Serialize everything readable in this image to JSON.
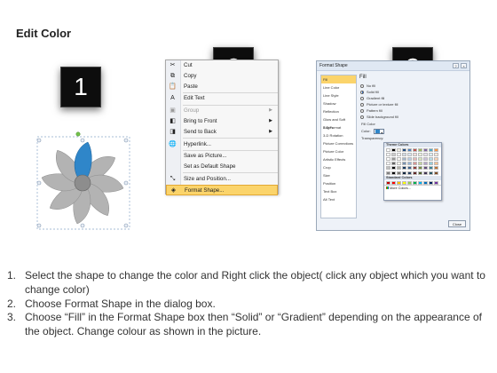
{
  "title": "Edit Color",
  "badges": [
    "1",
    "2",
    "3"
  ],
  "context_menu": {
    "items": [
      {
        "label": "Cut",
        "icon": "scissors-icon",
        "glyph": "✂",
        "disabled": false,
        "submenu": false
      },
      {
        "label": "Copy",
        "icon": "copy-icon",
        "glyph": "⧉",
        "disabled": false,
        "submenu": false
      },
      {
        "label": "Paste",
        "icon": "paste-icon",
        "glyph": "📋",
        "disabled": false,
        "submenu": false
      },
      {
        "label": "Edit Text",
        "icon": "edit-text-icon",
        "glyph": "A",
        "disabled": false,
        "submenu": false
      },
      {
        "label": "Group",
        "icon": "group-icon",
        "glyph": "▣",
        "disabled": true,
        "submenu": true
      },
      {
        "label": "Bring to Front",
        "icon": "bring-front-icon",
        "glyph": "◧",
        "disabled": false,
        "submenu": true
      },
      {
        "label": "Send to Back",
        "icon": "send-back-icon",
        "glyph": "◨",
        "disabled": false,
        "submenu": true
      },
      {
        "label": "Hyperlink...",
        "icon": "hyperlink-icon",
        "glyph": "🌐",
        "disabled": false,
        "submenu": false
      },
      {
        "label": "Save as Picture...",
        "icon": "",
        "glyph": "",
        "disabled": false,
        "submenu": false
      },
      {
        "label": "Set as Default Shape",
        "icon": "",
        "glyph": "",
        "disabled": false,
        "submenu": false
      },
      {
        "label": "Size and Position...",
        "icon": "size-position-icon",
        "glyph": "⤡",
        "disabled": false,
        "submenu": false
      },
      {
        "label": "Format Shape...",
        "icon": "format-shape-icon",
        "glyph": "◈",
        "disabled": false,
        "submenu": false,
        "highlighted": true
      }
    ]
  },
  "dialog": {
    "title": "Format Shape",
    "sidebar": [
      "Fill",
      "Line Color",
      "Line Style",
      "Shadow",
      "Reflection",
      "Glow and Soft Edges",
      "3-D Format",
      "3-D Rotation",
      "Picture Corrections",
      "Picture Color",
      "Artistic Effects",
      "Crop",
      "Size",
      "Position",
      "Text Box",
      "Alt Text"
    ],
    "pane_title": "Fill",
    "options": [
      "No fill",
      "Solid fill",
      "Gradient fill",
      "Picture or texture fill",
      "Pattern fill",
      "Slide background fill"
    ],
    "selected_option": "Solid fill",
    "fill_color_label": "Fill Color",
    "color_label": "Color:",
    "transparency_label": "Transparency:",
    "close": "Close"
  },
  "palette": {
    "theme_label": "Theme Colors",
    "standard_label": "Standard Colors",
    "more": "More Colors...",
    "theme_columns": [
      "#ffffff",
      "#000000",
      "#eeece1",
      "#1f497d",
      "#4f81bd",
      "#c0504d",
      "#9bbb59",
      "#8064a2",
      "#4bacc6",
      "#f79646"
    ],
    "standard_colors": [
      "#c00000",
      "#ff0000",
      "#ffc000",
      "#ffff00",
      "#92d050",
      "#00b050",
      "#00b0f0",
      "#0070c0",
      "#002060",
      "#7030a0"
    ]
  },
  "steps": [
    {
      "num": "1.",
      "text": "Select the shape to change the color and Right click the object( click any object which you want to change color)"
    },
    {
      "num": "2.",
      "text": "Choose Format Shape in the dialog box."
    },
    {
      "num": "3.",
      "text": "Choose “Fill” in the Format Shape box then “Solid” or “Gradient” depending on the appearance of the object. Change colour as shown in the picture."
    }
  ]
}
